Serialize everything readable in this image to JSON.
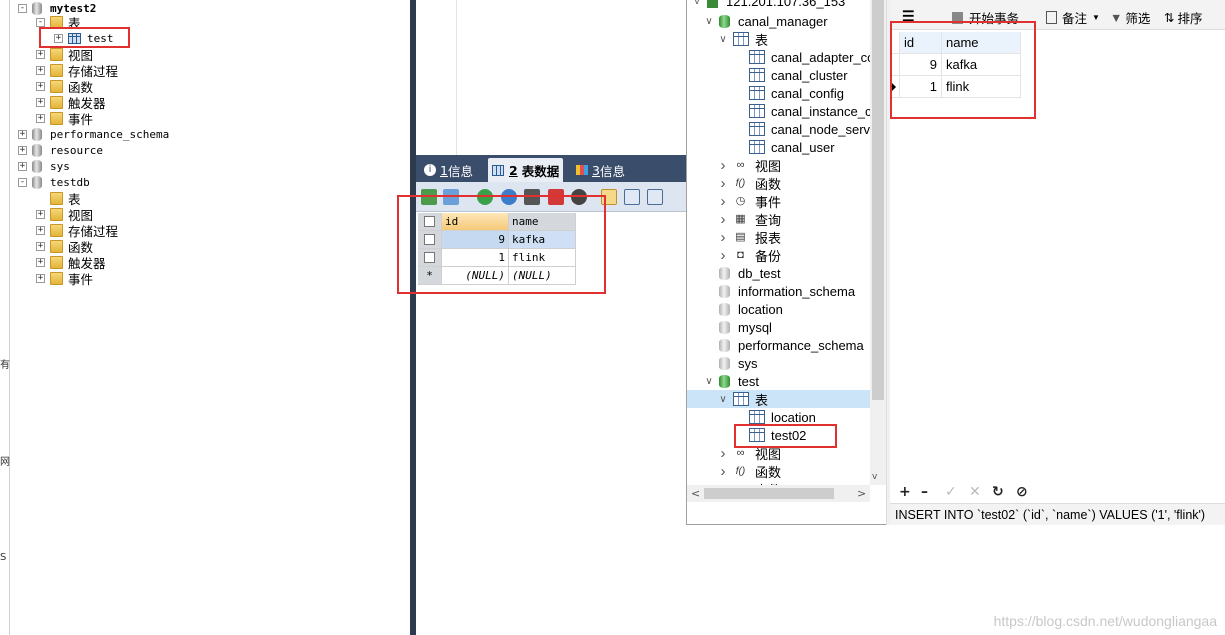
{
  "left_tree": {
    "items": [
      {
        "name": "mytest2",
        "type": "db",
        "expander": "-"
      },
      {
        "name": "表",
        "type": "folder",
        "expander": "-"
      },
      {
        "name": "test",
        "type": "table",
        "expander": "+"
      },
      {
        "name": "视图",
        "type": "folder",
        "expander": "+"
      },
      {
        "name": "存储过程",
        "type": "folder",
        "expander": "+"
      },
      {
        "name": "函数",
        "type": "folder",
        "expander": "+"
      },
      {
        "name": "触发器",
        "type": "folder",
        "expander": "+"
      },
      {
        "name": "事件",
        "type": "folder",
        "expander": "+"
      },
      {
        "name": "performance_schema",
        "type": "db",
        "expander": "+"
      },
      {
        "name": "resource",
        "type": "db",
        "expander": "+"
      },
      {
        "name": "sys",
        "type": "db",
        "expander": "+"
      },
      {
        "name": "testdb",
        "type": "db",
        "expander": "-"
      },
      {
        "name": "表",
        "type": "folder",
        "expander": ""
      },
      {
        "name": "视图",
        "type": "folder",
        "expander": "+"
      },
      {
        "name": "存储过程",
        "type": "folder",
        "expander": "+"
      },
      {
        "name": "函数",
        "type": "folder",
        "expander": "+"
      },
      {
        "name": "触发器",
        "type": "folder",
        "expander": "+"
      },
      {
        "name": "事件",
        "type": "folder",
        "expander": "+"
      }
    ],
    "strip_chars": [
      "有",
      "网",
      "S"
    ]
  },
  "middle": {
    "tabs": [
      {
        "num": "1",
        "label": "信息"
      },
      {
        "num": "2",
        "label": "表数据"
      },
      {
        "num": "3",
        "label": "信息"
      }
    ],
    "grid": {
      "columns": [
        "id",
        "name"
      ],
      "rows": [
        [
          "9",
          "kafka"
        ],
        [
          "1",
          "flink"
        ]
      ],
      "new_row": [
        "(NULL)",
        "(NULL)"
      ],
      "new_marker": "*"
    }
  },
  "navicat": {
    "connection": "121.201.107.36_153",
    "tree": [
      {
        "label": "canal_manager",
        "icon": "db-green",
        "chev": "v"
      },
      {
        "label": "表",
        "icon": "table",
        "chev": "v"
      },
      {
        "label": "canal_adapter_co",
        "icon": "table",
        "chev": ""
      },
      {
        "label": "canal_cluster",
        "icon": "table",
        "chev": ""
      },
      {
        "label": "canal_config",
        "icon": "table",
        "chev": ""
      },
      {
        "label": "canal_instance_co",
        "icon": "table",
        "chev": ""
      },
      {
        "label": "canal_node_serve",
        "icon": "table",
        "chev": ""
      },
      {
        "label": "canal_user",
        "icon": "table",
        "chev": ""
      },
      {
        "label": "视图",
        "icon": "oo",
        "chev": ">"
      },
      {
        "label": "函数",
        "icon": "fx",
        "chev": ">"
      },
      {
        "label": "事件",
        "icon": "clock",
        "chev": ">"
      },
      {
        "label": "查询",
        "icon": "query",
        "chev": ">"
      },
      {
        "label": "报表",
        "icon": "report",
        "chev": ">"
      },
      {
        "label": "备份",
        "icon": "backup",
        "chev": ">"
      },
      {
        "label": "db_test",
        "icon": "db-gray",
        "chev": ""
      },
      {
        "label": "information_schema",
        "icon": "db-gray",
        "chev": ""
      },
      {
        "label": "location",
        "icon": "db-gray",
        "chev": ""
      },
      {
        "label": "mysql",
        "icon": "db-gray",
        "chev": ""
      },
      {
        "label": "performance_schema",
        "icon": "db-gray",
        "chev": ""
      },
      {
        "label": "sys",
        "icon": "db-gray",
        "chev": ""
      },
      {
        "label": "test",
        "icon": "db-green",
        "chev": "v"
      },
      {
        "label": "表",
        "icon": "table",
        "chev": "v"
      },
      {
        "label": "location",
        "icon": "table",
        "chev": ""
      },
      {
        "label": "test02",
        "icon": "table",
        "chev": ""
      },
      {
        "label": "视图",
        "icon": "oo",
        "chev": ">"
      },
      {
        "label": "函数",
        "icon": "fx",
        "chev": ">"
      },
      {
        "label": "事件",
        "icon": "clock",
        "chev": ">"
      }
    ],
    "toolbar": {
      "begin_tx": "开始事务",
      "note": "备注",
      "filter": "筛选",
      "sort": "排序"
    },
    "grid": {
      "columns": [
        "id",
        "name"
      ],
      "rows": [
        [
          "9",
          "kafka"
        ],
        [
          "1",
          "flink"
        ]
      ]
    },
    "status_sql": "INSERT INTO `test02` (`id`, `name`) VALUES ('1', 'flink')"
  },
  "watermark": "https://blog.csdn.net/wudongliangaa"
}
